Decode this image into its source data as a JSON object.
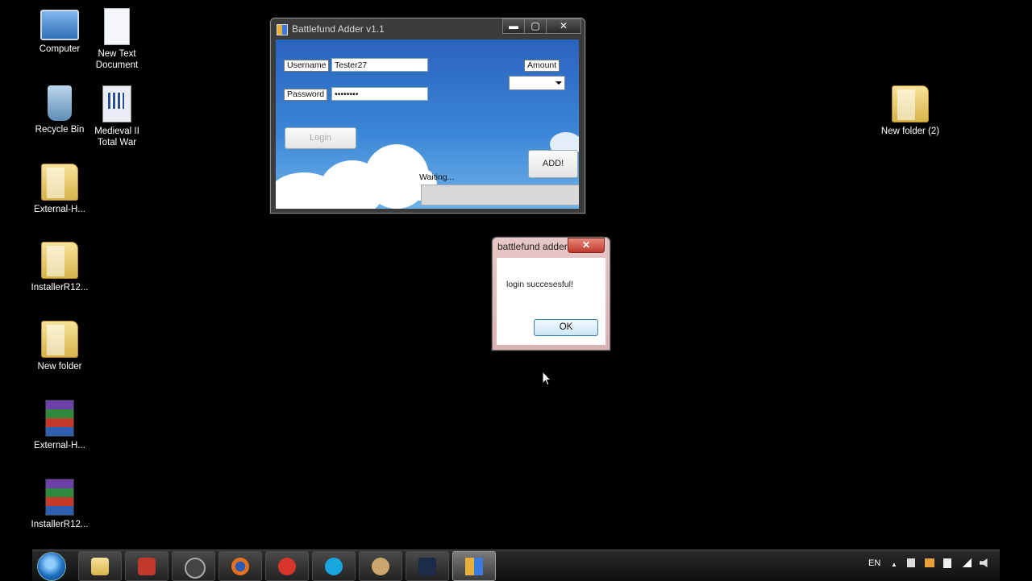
{
  "desktop": {
    "icons": [
      {
        "label": "Computer"
      },
      {
        "label": "New Text Document"
      },
      {
        "label": "Recycle Bin"
      },
      {
        "label": "Medieval II Total War"
      },
      {
        "label": "External-H..."
      },
      {
        "label": "InstallerR12..."
      },
      {
        "label": "New folder"
      },
      {
        "label": "External-H..."
      },
      {
        "label": "InstallerR12..."
      },
      {
        "label": "New folder (2)"
      }
    ]
  },
  "app_window": {
    "title": "Battlefund Adder v1.1",
    "username_label": "Username",
    "username_value": "Tester27",
    "password_label": "Password",
    "password_value": "••••••••",
    "amount_label": "Amount",
    "amount_value": "",
    "login_button": "Login",
    "add_button": "ADD!",
    "status_text": "Waiting...",
    "minimize": "▬",
    "maximize": "▢",
    "close": "✕"
  },
  "message_box": {
    "title": "battlefund adder",
    "message": "login succesesful!",
    "ok_button": "OK",
    "close": "✕"
  },
  "taskbar": {
    "language": "EN",
    "tray_arrow": "▲",
    "pinned": [
      "explorer",
      "mcafee",
      "steam",
      "firefox",
      "ccleaner",
      "skype",
      "paint",
      "webcam",
      "battlefund-adder"
    ]
  }
}
